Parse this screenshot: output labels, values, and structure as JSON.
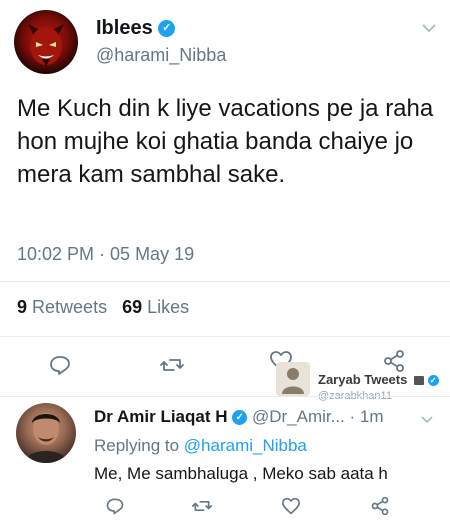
{
  "tweet": {
    "display_name": "Iblees",
    "handle": "@harami_Nibba",
    "text": "Me Kuch din k liye vacations pe ja raha hon mujhe koi ghatia banda chaiye jo mera kam sambhal sake.",
    "timestamp": "10:02 PM · 05 May 19",
    "retweets_count": "9",
    "retweets_label": "Retweets",
    "likes_count": "69",
    "likes_label": "Likes"
  },
  "watermark": {
    "name": "Zaryab Tweets",
    "handle": "@zarabkhan11"
  },
  "reply": {
    "display_name": "Dr Amir Liaqat H",
    "handle": "@Dr_Amir...",
    "time": "· 1m",
    "replying_prefix": "Replying to",
    "replying_handle": "@harami_Nibba",
    "text": "Me, Me sambhaluga , Meko sab aata h"
  },
  "icons": {
    "verified": "verified-badge-icon",
    "chevron": "chevron-down-icon",
    "reply": "reply-icon",
    "retweet": "retweet-icon",
    "like": "heart-icon",
    "share": "share-icon"
  },
  "colors": {
    "accent": "#1da1f2",
    "muted": "#657786",
    "text": "#14171a",
    "divider": "#e6ecf0"
  }
}
